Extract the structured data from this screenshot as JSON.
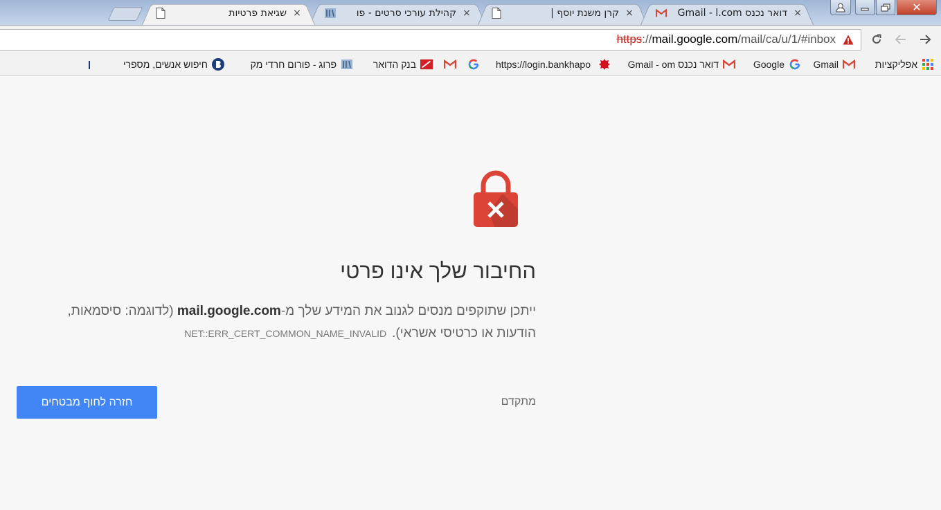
{
  "tabs": [
    {
      "title": "שגיאת פרטיות",
      "favicon": "document-icon",
      "active": true
    },
    {
      "title": "קהילת עורכי סרטים - פו",
      "favicon": "forum-icon",
      "active": false
    },
    {
      "title": "קרן משנת יוסף |",
      "favicon": "document-icon",
      "active": false
    },
    {
      "title": "דואר נכנס Gmail - l.com",
      "favicon": "gmail-icon",
      "active": false
    }
  ],
  "tab_close_glyph": "×",
  "window": {
    "close_glyph": "✕"
  },
  "omnibox": {
    "scheme": "https",
    "separator": "://",
    "host": "mail.google.com",
    "path": "/mail/ca/u/1/#inbox"
  },
  "bookmarks": [
    {
      "label": "אפליקציות",
      "icon": "apps-grid-icon"
    },
    {
      "label": "Gmail",
      "icon": "gmail-icon"
    },
    {
      "label": "Google",
      "icon": "google-icon"
    },
    {
      "label": "דואר נכנס Gmail - om",
      "icon": "gmail-icon"
    },
    {
      "label": "",
      "icon": "red-leaf-icon"
    },
    {
      "label": "https://login.bankhapo",
      "icon": ""
    },
    {
      "label": "",
      "icon": "google-icon"
    },
    {
      "label": "",
      "icon": "gmail-icon"
    },
    {
      "label": "בנק הדואר",
      "icon": "bank-icon"
    },
    {
      "label": "פרוג - פורום חרדי מק",
      "icon": "forum-icon"
    },
    {
      "label": "חיפוש אנשים, מספרי",
      "icon": "b-logo-icon"
    }
  ],
  "interstitial": {
    "heading": "החיבור שלך אינו פרטי",
    "explanation_pre": "ייתכן שתוקפים מנסים לגנוב את המידע שלך מ-",
    "explanation_host": "mail.google.com",
    "explanation_post": " (לדוגמה: סיסמאות, הודעות או כרטיסי אשראי).",
    "error_code": "NET::ERR_CERT_COMMON_NAME_INVALID",
    "advanced_label": "מתקדם",
    "back_button_label": "חזרה לחוף מבטחים"
  },
  "colors": {
    "lock_red": "#db4437",
    "button_blue": "#4285f4",
    "url_warning_red": "#c5261f"
  }
}
